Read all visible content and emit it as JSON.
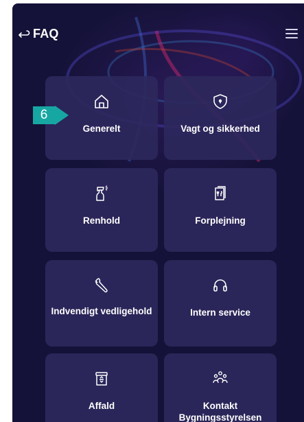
{
  "header": {
    "title": "FAQ",
    "back_icon": "back-arrow-icon",
    "menu_icon": "hamburger-menu-icon"
  },
  "annotation": {
    "step_number": "6",
    "color": "#17a7a3"
  },
  "tiles": [
    {
      "label": "Generelt",
      "icon": "home-icon"
    },
    {
      "label": "Vagt og sikkerhed",
      "icon": "shield-icon"
    },
    {
      "label": "Renhold",
      "icon": "spray-bottle-icon"
    },
    {
      "label": "Forplejning",
      "icon": "menu-card-icon"
    },
    {
      "label": "Indvendigt vedligehold",
      "icon": "wrench-icon"
    },
    {
      "label": "Intern service",
      "icon": "headset-icon"
    },
    {
      "label": "Affald",
      "icon": "recycle-bin-icon"
    },
    {
      "label": "Kontakt Bygningsstyrelsen",
      "icon": "people-group-icon"
    }
  ],
  "colors": {
    "background": "#141238",
    "tile": "#2c285c",
    "text": "#ffffff"
  }
}
